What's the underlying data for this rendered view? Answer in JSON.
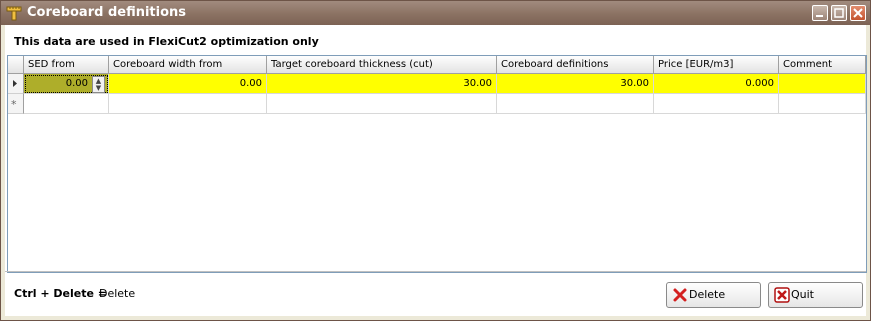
{
  "window": {
    "title": "Coreboard definitions"
  },
  "info_text": "This data are used in FlexiCut2 optimization only",
  "grid": {
    "columns": [
      "SED from",
      "Coreboard width from",
      "Target coreboard thickness (cut)",
      "Coreboard definitions",
      "Price [EUR/m3]",
      "Comment"
    ],
    "rows": [
      {
        "sed_from": "0.00",
        "width_from": "0.00",
        "target_thickness": "30.00",
        "definitions": "30.00",
        "price": "0.000",
        "comment": ""
      }
    ],
    "highlight_color": "#ffff00",
    "selected_cell_color": "#aeae2a"
  },
  "footer": {
    "shortcut": "Ctrl + Delete =",
    "shortcut_action": "Delete"
  },
  "buttons": {
    "delete": "Delete",
    "quit": "Quit"
  },
  "colors": {
    "titlebar": "#8b7263",
    "window_bg": "#ece9d8"
  }
}
